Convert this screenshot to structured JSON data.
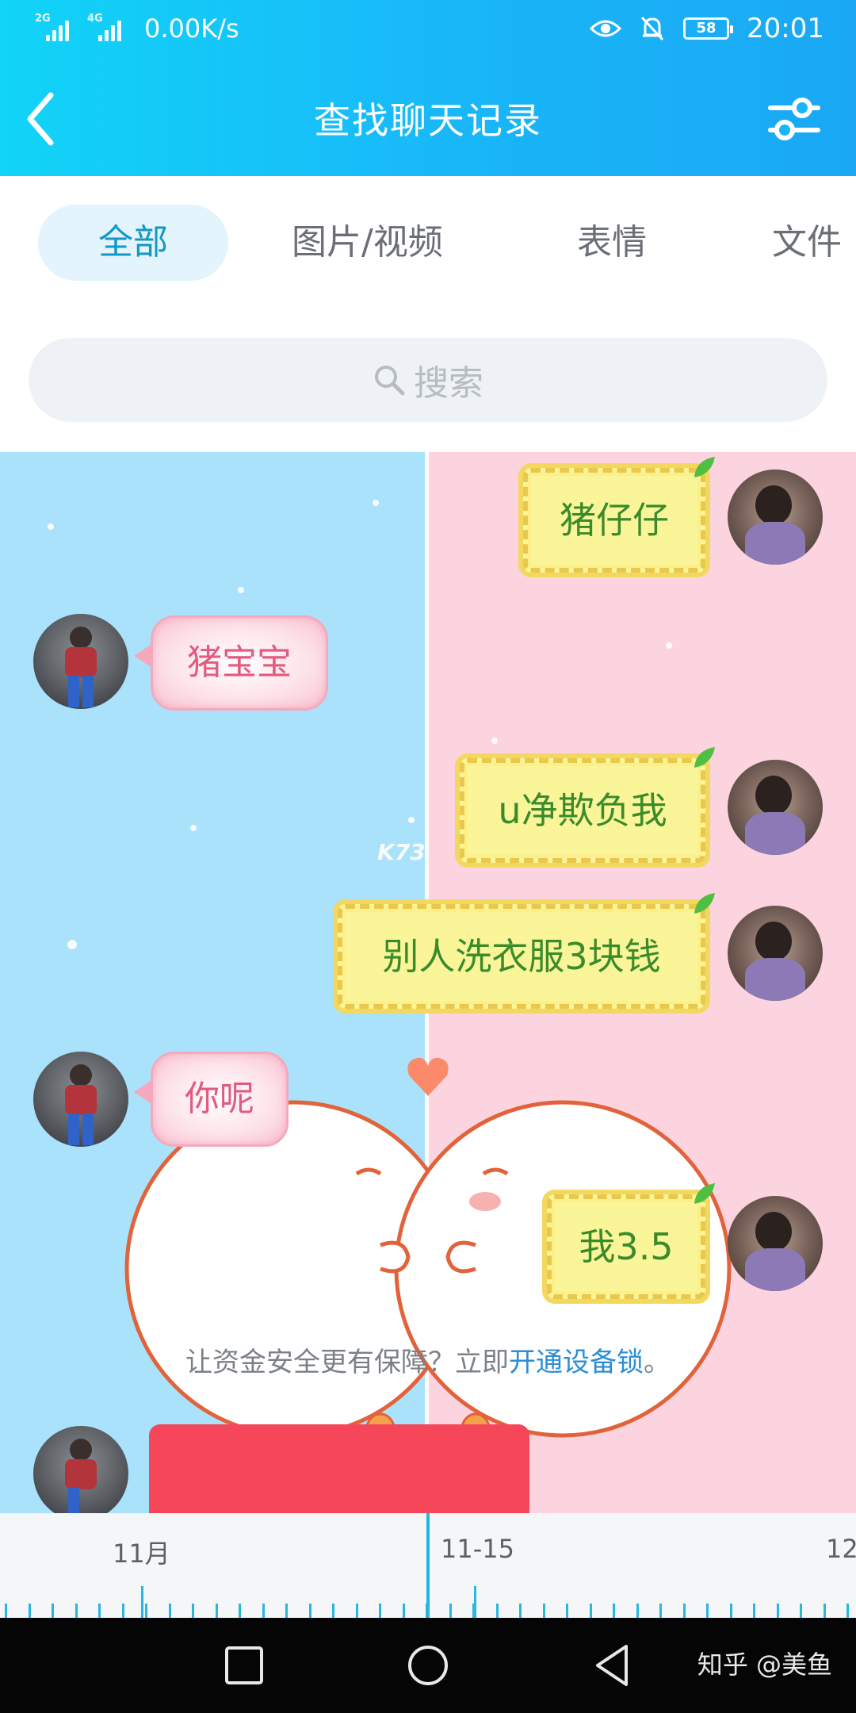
{
  "status_bar": {
    "network_1": "2G",
    "network_2": "4G",
    "speed": "0.00K/s",
    "battery": "58",
    "time": "20:01"
  },
  "header": {
    "title": "查找聊天记录",
    "back_icon": "chevron-left-icon",
    "filter_icon": "sliders-icon"
  },
  "tabs": [
    {
      "label": "全部",
      "active": true
    },
    {
      "label": "图片/视频",
      "active": false
    },
    {
      "label": "表情",
      "active": false
    },
    {
      "label": "文件",
      "active": false
    }
  ],
  "search": {
    "placeholder": "搜索"
  },
  "messages": [
    {
      "side": "right",
      "text": "猪仔仔"
    },
    {
      "side": "left",
      "text": "猪宝宝"
    },
    {
      "side": "right",
      "text": "u净欺负我"
    },
    {
      "side": "right",
      "text": "别人洗衣服3块钱"
    },
    {
      "side": "left",
      "text": "你呢"
    },
    {
      "side": "right",
      "text": "我3.5"
    }
  ],
  "watermark_center": "K73",
  "notice": {
    "text": "让资金安全更有保障？立即",
    "link": "开通设备锁",
    "suffix": "。"
  },
  "timeline": {
    "labels": [
      "11月",
      "11-15",
      "12"
    ]
  },
  "bottom_watermark": "知乎 @美鱼",
  "colors": {
    "header": "#19b6f8",
    "accent": "#24b5de",
    "left_bg": "#a9e2fa",
    "right_bg": "#fcd4df"
  }
}
